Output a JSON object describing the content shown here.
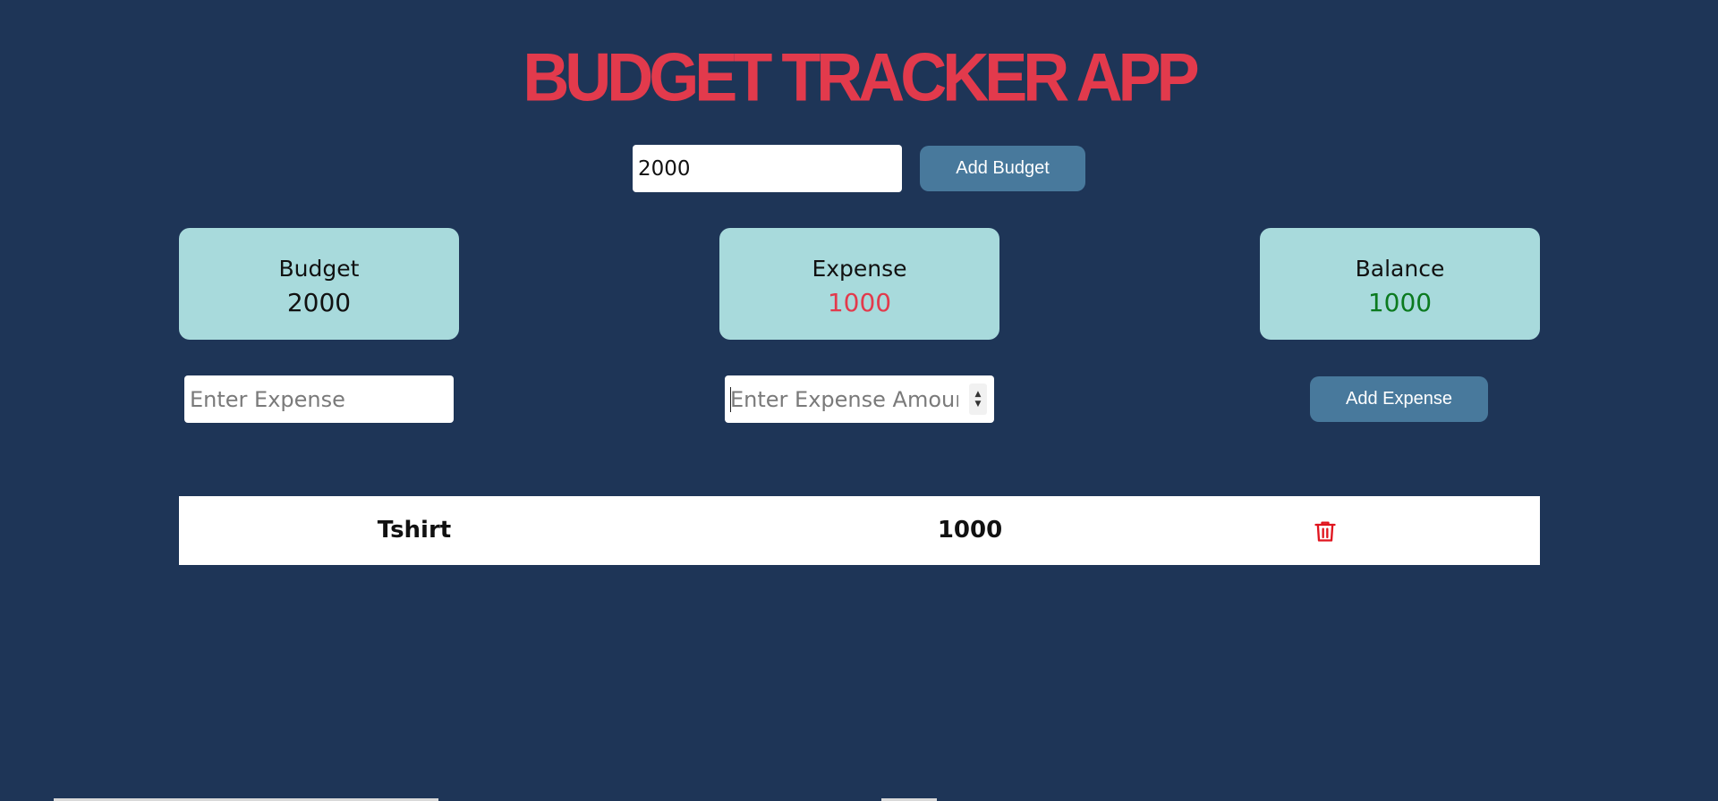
{
  "header": {
    "title": "BUDGET TRACKER APP"
  },
  "budget_form": {
    "input_value": "2000",
    "add_button_label": "Add Budget"
  },
  "summary": {
    "budget": {
      "label": "Budget",
      "value": "2000",
      "color": "#111111"
    },
    "expense": {
      "label": "Expense",
      "value": "1000",
      "color": "#e23a4c"
    },
    "balance": {
      "label": "Balance",
      "value": "1000",
      "color": "#0b7a1f"
    }
  },
  "expense_form": {
    "name_placeholder": "Enter Expense",
    "amount_placeholder": "Enter Expense Amount",
    "add_button_label": "Add Expense"
  },
  "expenses": [
    {
      "name": "Tshirt",
      "amount": "1000",
      "delete_icon": "trash-icon"
    }
  ],
  "colors": {
    "background": "#1e3557",
    "title": "#e23a4c",
    "card": "#a8dadc",
    "button": "#48799c",
    "delete": "#e0141e"
  }
}
